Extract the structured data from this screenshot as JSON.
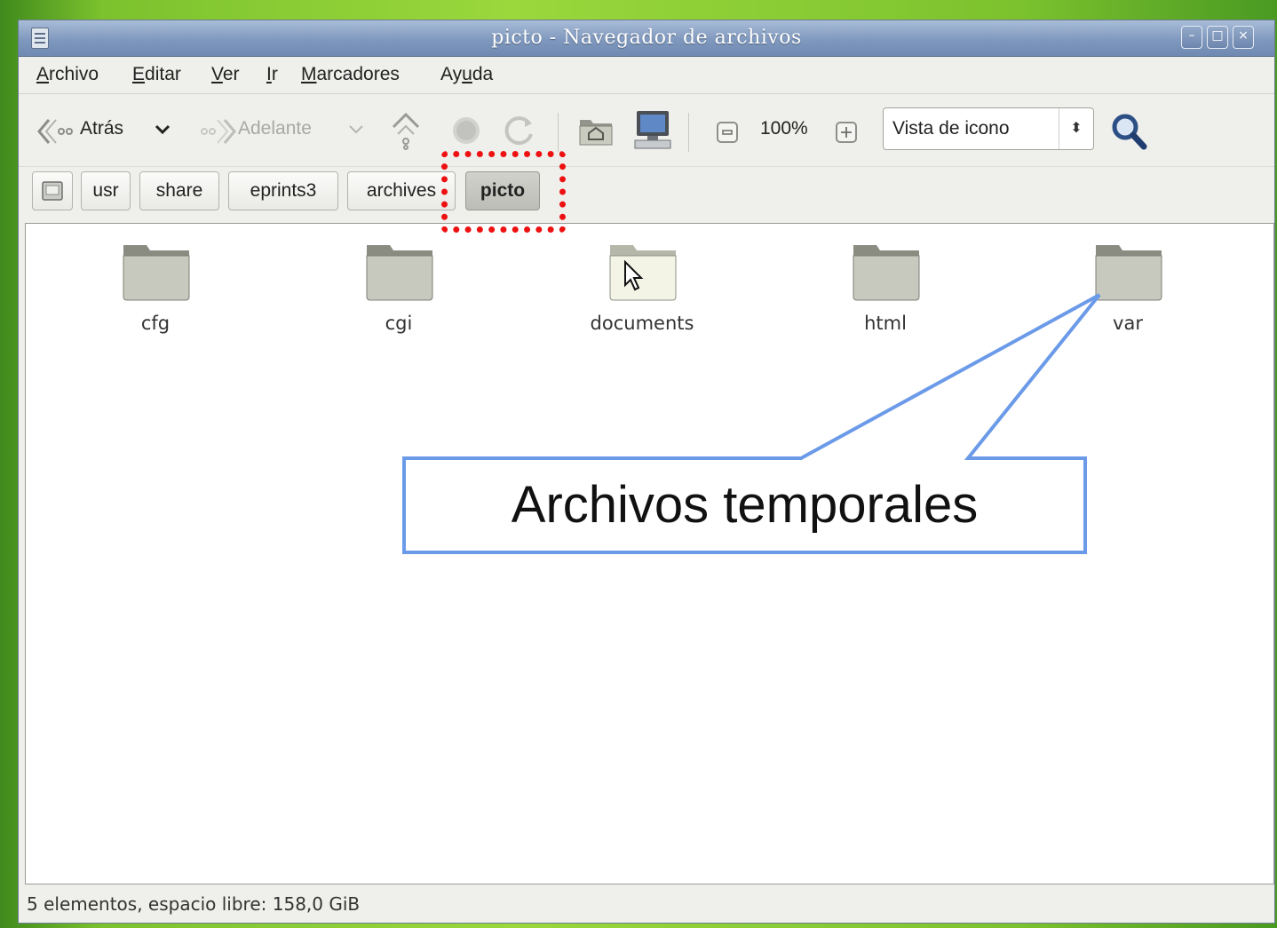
{
  "window": {
    "title": "picto - Navegador de archivos",
    "buttons": {
      "minimize": "–",
      "maximize": "□",
      "close": "×"
    }
  },
  "menubar": {
    "items": [
      {
        "label": "Archivo",
        "mnemonic": "A",
        "rest": "rchivo"
      },
      {
        "label": "Editar",
        "mnemonic": "E",
        "rest": "ditar"
      },
      {
        "label": "Ver",
        "mnemonic": "V",
        "rest": "er"
      },
      {
        "label": "Ir",
        "mnemonic": "I",
        "rest": "r"
      },
      {
        "label": "Marcadores",
        "mnemonic": "M",
        "rest": "arcadores"
      },
      {
        "label": "Ayuda",
        "pre": "Ay",
        "mnemonic": "u",
        "rest": "da"
      }
    ]
  },
  "toolbar": {
    "back_label": "Atrás",
    "forward_label": "Adelante",
    "zoom_level": "100%",
    "view_mode": "Vista de icono"
  },
  "pathbar": {
    "crumbs": [
      "usr",
      "share",
      "eprints3",
      "archives",
      "picto"
    ],
    "active": "picto"
  },
  "folders": [
    {
      "name": "cfg"
    },
    {
      "name": "cgi"
    },
    {
      "name": "documents"
    },
    {
      "name": "html"
    },
    {
      "name": "var"
    }
  ],
  "status": {
    "text": "5 elementos, espacio libre: 158,0 GiB"
  },
  "annotation": {
    "callout_text": "Archivos temporales",
    "callout_color": "#6b9ae8",
    "highlight_color": "#ee1111"
  }
}
